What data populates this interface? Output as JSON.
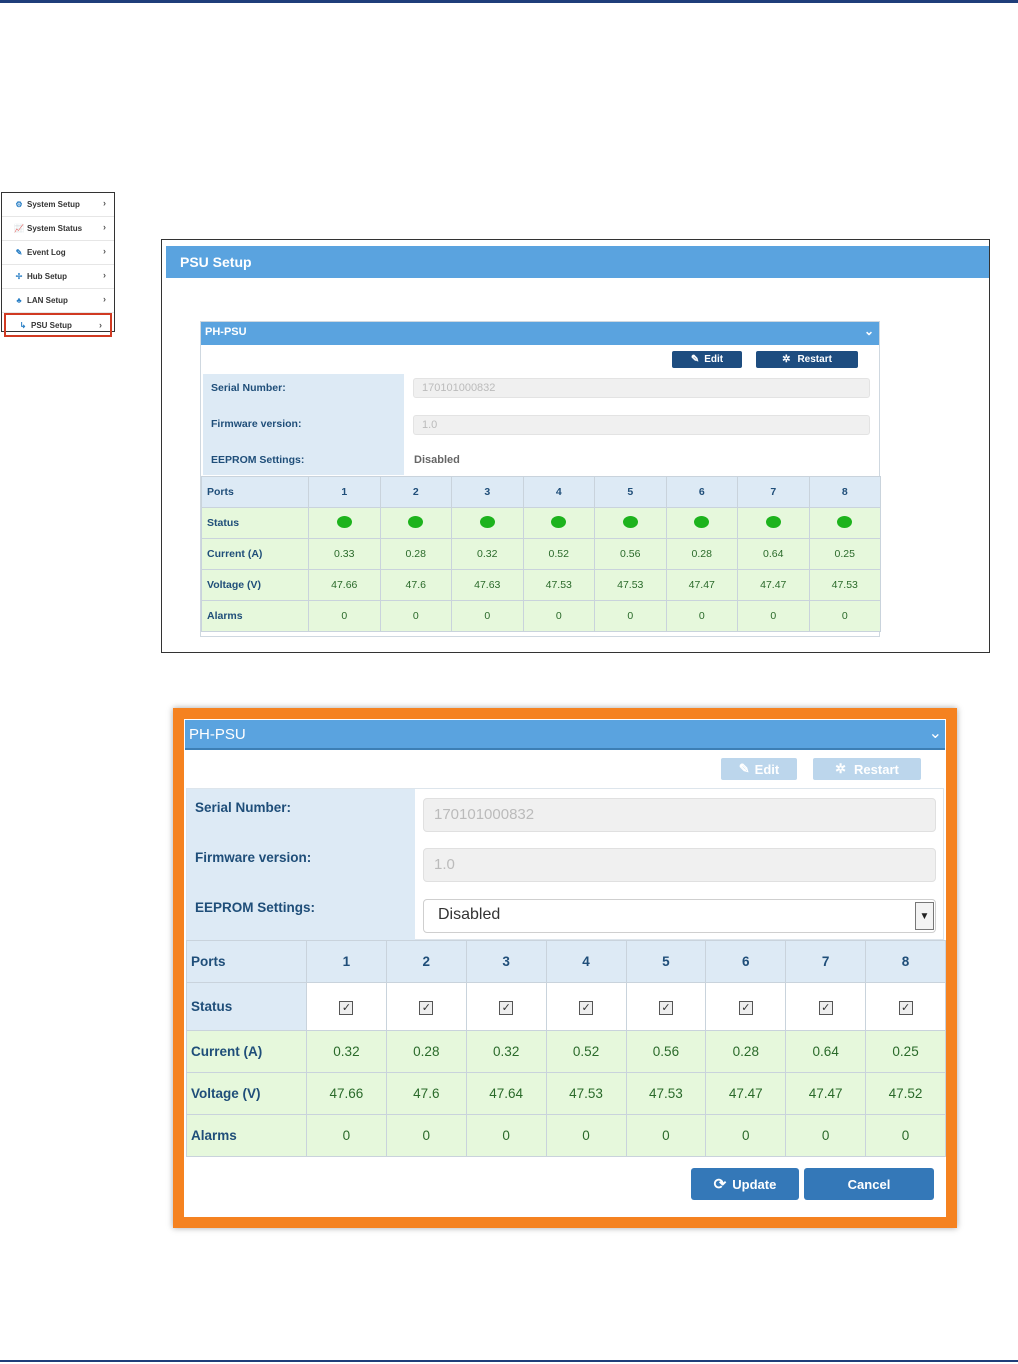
{
  "colors": {
    "header_blue": "#5aa3df",
    "label_bg": "#ddeaf5",
    "data_bg": "#e6f8dc",
    "highlight_orange": "#f58220",
    "active_red": "#d03a22",
    "status_green": "#1db31d",
    "button_dark": "#1e4d80"
  },
  "sidebar": {
    "items": [
      {
        "label": "System Setup",
        "icon": "gear-icon",
        "glyph": "⚙"
      },
      {
        "label": "System Status",
        "icon": "chart-line-icon",
        "glyph": "📈"
      },
      {
        "label": "Event Log",
        "icon": "edit-icon",
        "glyph": "✎"
      },
      {
        "label": "Hub Setup",
        "icon": "hub-icon",
        "glyph": "✢"
      },
      {
        "label": "LAN Setup",
        "icon": "network-icon",
        "glyph": "♣"
      },
      {
        "label": "PSU Setup",
        "icon": "psu-icon",
        "glyph": "↳",
        "active": true
      }
    ],
    "chevron": "›"
  },
  "screen1": {
    "page_title": "PSU Setup",
    "panel_title": "PH-PSU",
    "chevron": "⌄",
    "edit_label": "Edit",
    "edit_glyph": "✎",
    "restart_label": "Restart",
    "restart_glyph": "✲",
    "serial_label": "Serial Number:",
    "serial_value": "170101000832",
    "firmware_label": "Firmware version:",
    "firmware_value": "1.0",
    "eeprom_label": "EEPROM Settings:",
    "eeprom_value": "Disabled",
    "row_labels": {
      "ports": "Ports",
      "status": "Status",
      "current": "Current (A)",
      "voltage": "Voltage (V)",
      "alarms": "Alarms"
    },
    "ports": [
      "1",
      "2",
      "3",
      "4",
      "5",
      "6",
      "7",
      "8"
    ],
    "status": [
      "on",
      "on",
      "on",
      "on",
      "on",
      "on",
      "on",
      "on"
    ],
    "current": [
      "0.33",
      "0.28",
      "0.32",
      "0.52",
      "0.56",
      "0.28",
      "0.64",
      "0.25"
    ],
    "voltage": [
      "47.66",
      "47.6",
      "47.63",
      "47.53",
      "47.53",
      "47.47",
      "47.47",
      "47.53"
    ],
    "alarms": [
      "0",
      "0",
      "0",
      "0",
      "0",
      "0",
      "0",
      "0"
    ]
  },
  "screen2": {
    "panel_title": "PH-PSU",
    "chevron": "⌄",
    "edit_label": "Edit",
    "edit_glyph": "✎",
    "restart_label": "Restart",
    "restart_glyph": "✲",
    "serial_label": "Serial Number:",
    "serial_value": "170101000832",
    "firmware_label": "Firmware version:",
    "firmware_value": "1.0",
    "eeprom_label": "EEPROM Settings:",
    "eeprom_value": "Disabled",
    "select_arrow": "▼",
    "row_labels": {
      "ports": "Ports",
      "status": "Status",
      "current": "Current (A)",
      "voltage": "Voltage (V)",
      "alarms": "Alarms"
    },
    "ports": [
      "1",
      "2",
      "3",
      "4",
      "5",
      "6",
      "7",
      "8"
    ],
    "status_checked": [
      true,
      true,
      true,
      true,
      true,
      true,
      true,
      true
    ],
    "check_glyph": "✓",
    "current": [
      "0.32",
      "0.28",
      "0.32",
      "0.52",
      "0.56",
      "0.28",
      "0.64",
      "0.25"
    ],
    "voltage": [
      "47.66",
      "47.6",
      "47.64",
      "47.53",
      "47.53",
      "47.47",
      "47.47",
      "47.52"
    ],
    "alarms": [
      "0",
      "0",
      "0",
      "0",
      "0",
      "0",
      "0",
      "0"
    ],
    "update_label": "Update",
    "update_glyph": "⟳",
    "cancel_label": "Cancel"
  }
}
